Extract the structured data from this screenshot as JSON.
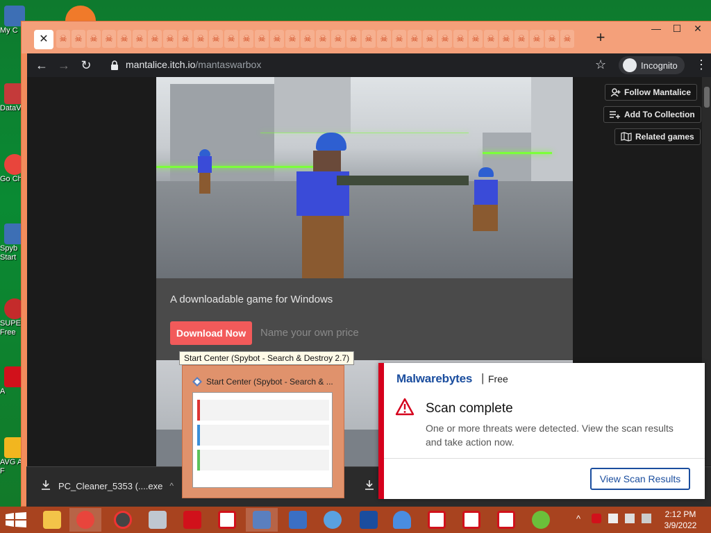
{
  "desktop": {
    "icons": [
      {
        "label": "My C"
      },
      {
        "label": "DataV"
      },
      {
        "label": "Go Ch"
      },
      {
        "label": "Spyb Start"
      },
      {
        "label": "SUPE Free"
      },
      {
        "label": "A"
      },
      {
        "label": "AVG A F"
      }
    ]
  },
  "browser": {
    "tab_close": "✕",
    "tab_icon": "☠",
    "new_tab": "+",
    "window_controls": {
      "minimize": "—",
      "maximize": "☐",
      "close": "✕"
    },
    "nav": {
      "back": "←",
      "forward": "→",
      "reload": "↻"
    },
    "url_host": "mantalice.itch.io",
    "url_path": "/mantaswarbox",
    "incognito_label": "Incognito",
    "menu": "⋮",
    "bookmark": "☆"
  },
  "page": {
    "tagline": "A downloadable game for Windows",
    "download_button": "Download Now",
    "price_text": "Name your own price",
    "sidebar_buttons": {
      "follow": "Follow Mantalice",
      "collection": "Add To Collection",
      "related": "Related games"
    }
  },
  "download_bar": {
    "file_name": "PC_Cleaner_5353 (....exe",
    "caret": "^"
  },
  "spybot": {
    "tooltip": "Start Center (Spybot - Search & Destroy 2.7)",
    "thumb_title": "Start Center (Spybot - Search & ..."
  },
  "malwarebytes": {
    "brand": "Malwarebytes",
    "separator": "|",
    "edition": "Free",
    "title": "Scan complete",
    "message": "One or more threats were detected. View the scan results and take action now.",
    "button": "View Scan Results"
  },
  "taskbar": {
    "time": "2:12 PM",
    "date": "3/9/2022",
    "tray_caret": "^"
  },
  "colors": {
    "accent_download": "#f25a5a",
    "malwarebytes_red": "#d5001c",
    "malwarebytes_blue": "#1a4d9e",
    "taskbar": "#a8431f"
  }
}
